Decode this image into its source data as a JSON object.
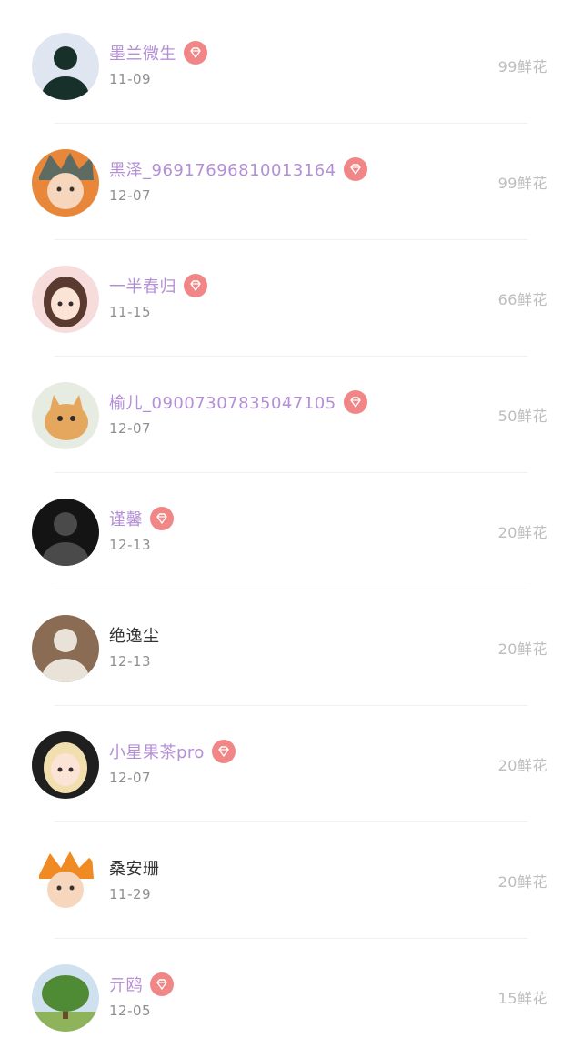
{
  "colors": {
    "vip_name": "#b58fd6",
    "regular_name": "#333333",
    "vip_badge": "#f08686",
    "date": "#8f8f8f",
    "amount": "#bdbdbd"
  },
  "icons": {
    "vip_badge": "diamond-icon"
  },
  "items": [
    {
      "name": "墨兰微生",
      "date": "11-09",
      "amount": "99鲜花",
      "vip": true,
      "avatar": {
        "icon": "person-avatar-icon",
        "bg": "#dfe6f1",
        "fg": "#17302a"
      }
    },
    {
      "name": "黑泽_96917696810013164",
      "date": "12-07",
      "amount": "99鲜花",
      "vip": true,
      "avatar": {
        "icon": "anime-character-avatar-icon",
        "bg": "#e8873a",
        "fg": "#5d6b63"
      }
    },
    {
      "name": "一半春归",
      "date": "11-15",
      "amount": "66鲜花",
      "vip": true,
      "avatar": {
        "icon": "anime-girl-avatar-icon",
        "bg": "#f7dcdc",
        "fg": "#5a3a30"
      }
    },
    {
      "name": "榆儿_09007307835047105",
      "date": "12-07",
      "amount": "50鲜花",
      "vip": true,
      "avatar": {
        "icon": "cat-avatar-icon",
        "bg": "#e6ece2",
        "fg": "#e5a75d"
      }
    },
    {
      "name": "谨馨",
      "date": "12-13",
      "amount": "20鲜花",
      "vip": true,
      "avatar": {
        "icon": "person-avatar-icon",
        "bg": "#141414",
        "fg": "#4a4a4a"
      }
    },
    {
      "name": "绝逸尘",
      "date": "12-13",
      "amount": "20鲜花",
      "vip": false,
      "avatar": {
        "icon": "person-avatar-icon",
        "bg": "#8a6c55",
        "fg": "#e9e2d8"
      }
    },
    {
      "name": "小星果茶pro",
      "date": "12-07",
      "amount": "20鲜花",
      "vip": true,
      "avatar": {
        "icon": "anime-girl-avatar-icon",
        "bg": "#1f1f1f",
        "fg": "#f1dfb0"
      }
    },
    {
      "name": "桑安珊",
      "date": "11-29",
      "amount": "20鲜花",
      "vip": false,
      "avatar": {
        "icon": "anime-character-avatar-icon",
        "bg": "#ffffff",
        "fg": "#f08a22"
      }
    },
    {
      "name": "亓鸥",
      "date": "12-05",
      "amount": "15鲜花",
      "vip": true,
      "avatar": {
        "icon": "tree-avatar-icon",
        "bg": "#cfe1ef",
        "fg": "#4f8a35"
      }
    }
  ]
}
